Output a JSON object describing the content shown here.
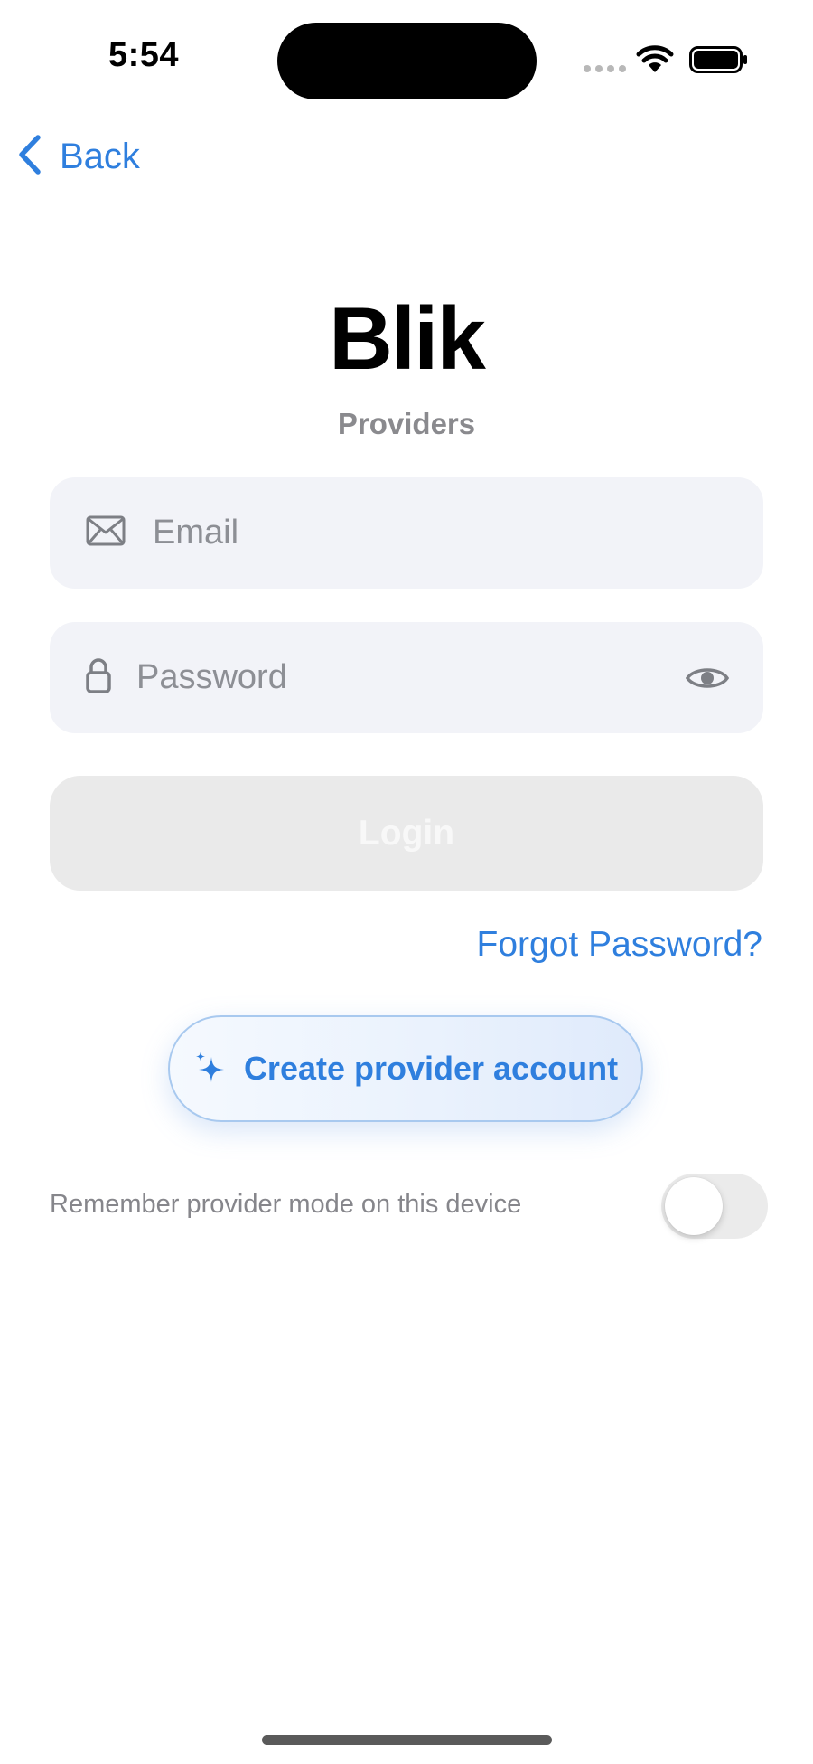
{
  "status_bar": {
    "time": "5:54"
  },
  "nav": {
    "back_label": "Back"
  },
  "header": {
    "title": "Blik",
    "subtitle": "Providers"
  },
  "form": {
    "email_placeholder": "Email",
    "email_value": "",
    "password_placeholder": "Password",
    "password_value": "",
    "login_label": "Login",
    "forgot_label": "Forgot Password?",
    "create_account_label": "Create provider account"
  },
  "remember": {
    "label": "Remember provider mode on this device",
    "enabled": false
  },
  "icons": {
    "back": "chevron-left-icon",
    "email": "envelope-icon",
    "password": "lock-icon",
    "show_password": "eye-icon",
    "create_account": "sparkles-icon"
  },
  "colors": {
    "accent": "#2f7fde",
    "field_background": "#f2f3f8",
    "login_disabled": "#eaeaea",
    "secondary_text": "#8a8a8e"
  }
}
